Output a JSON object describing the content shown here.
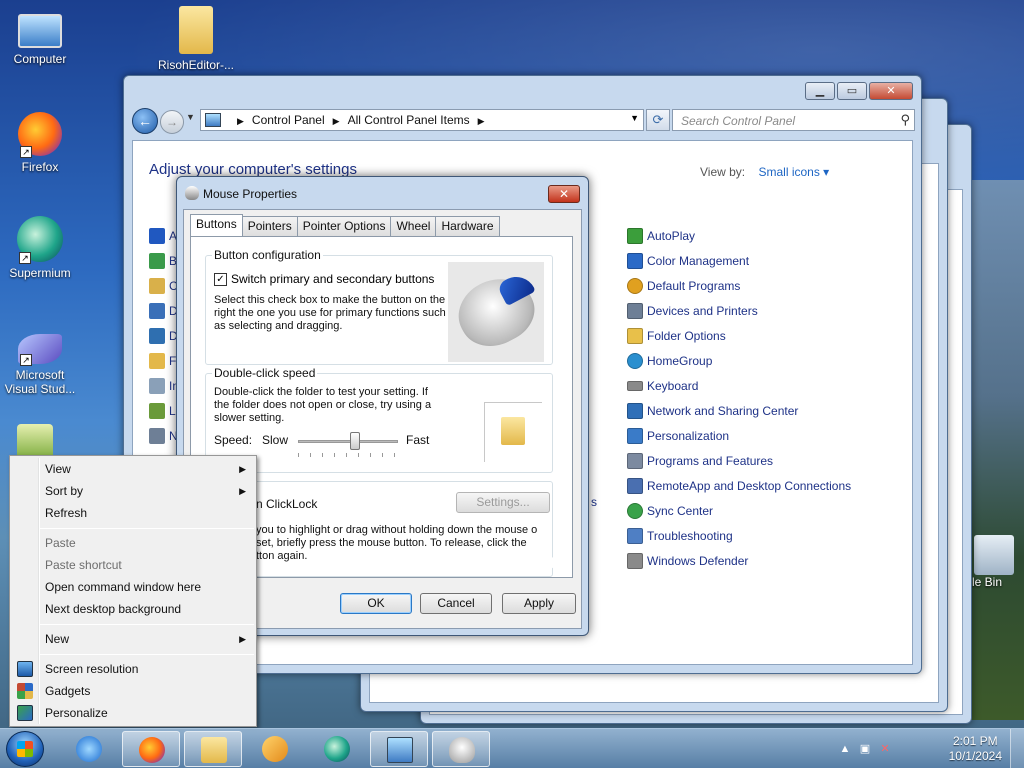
{
  "desktop": {
    "icons": [
      {
        "label": "Computer",
        "icon": "computer-icon"
      },
      {
        "label": "RisohEditor-...",
        "icon": "folder-icon"
      },
      {
        "label": "Firefox",
        "icon": "firefox-icon"
      },
      {
        "label": "Supermium",
        "icon": "supermium-icon"
      },
      {
        "label": "Microsoft Visual Stud...",
        "icon": "visual-studio-icon"
      },
      {
        "label": "cle Bin",
        "icon": "recycle-bin-icon"
      }
    ]
  },
  "explorer": {
    "breadcrumb": [
      "Control Panel",
      "All Control Panel Items"
    ],
    "search_placeholder": "Search Control Panel",
    "heading": "Adjust your computer's settings",
    "view_by_label": "View by:",
    "view_by_value": "Small icons",
    "left_items": [
      "A",
      "B",
      "C",
      "D",
      "D",
      "F",
      "In",
      "Lo",
      "N"
    ],
    "right_items": [
      {
        "label": "AutoPlay",
        "color": "#3b9e3b"
      },
      {
        "label": "Color Management",
        "color": "#2b6ac7"
      },
      {
        "label": "Default Programs",
        "color": "#e0a020"
      },
      {
        "label": "Devices and Printers",
        "color": "#6e7f96"
      },
      {
        "label": "Folder Options",
        "color": "#e8c04a"
      },
      {
        "label": "HomeGroup",
        "color": "#2a8fcf"
      },
      {
        "label": "Keyboard",
        "color": "#8a8a8a"
      },
      {
        "label": "Network and Sharing Center",
        "color": "#2f6fb8"
      },
      {
        "label": "Personalization",
        "color": "#3a7bc8"
      },
      {
        "label": "Programs and Features",
        "color": "#7c8aa0"
      },
      {
        "label": "RemoteApp and Desktop Connections",
        "color": "#4a6fb0"
      },
      {
        "label": "Sync Center",
        "color": "#3aa24a"
      },
      {
        "label": "Troubleshooting",
        "color": "#4f7fc4"
      },
      {
        "label": "Windows Defender",
        "color": "#8a8a8a"
      }
    ],
    "partial_text": "s"
  },
  "dialog": {
    "title": "Mouse Properties",
    "tabs": [
      "Buttons",
      "Pointers",
      "Pointer Options",
      "Wheel",
      "Hardware"
    ],
    "active_tab": "Buttons",
    "button_config": {
      "label": "Button configuration",
      "checkbox_label": "Switch primary and secondary buttons",
      "checked": true,
      "description": "Select this check box to make the button on the right the one you use for primary functions such as selecting and dragging."
    },
    "double_click": {
      "label": "Double-click speed",
      "description": "Double-click the folder to test your setting. If the folder does not open or close, try using a slower setting.",
      "speed_label": "Speed:",
      "slow_label": "Slow",
      "fast_label": "Fast",
      "speed_value": 0.57
    },
    "clicklock": {
      "label": "n ClickLock",
      "settings_button": "Settings...",
      "description": "you to highlight or drag without holding down the mouse o set, briefly press the mouse button. To release, click the tton again."
    },
    "buttons": {
      "ok": "OK",
      "cancel": "Cancel",
      "apply": "Apply"
    }
  },
  "context_menu": {
    "items": [
      {
        "label": "View",
        "submenu": true,
        "disabled": false
      },
      {
        "label": "Sort by",
        "submenu": true,
        "disabled": false
      },
      {
        "label": "Refresh",
        "submenu": false,
        "disabled": false
      },
      {
        "label": "Paste",
        "submenu": false,
        "disabled": true
      },
      {
        "label": "Paste shortcut",
        "submenu": false,
        "disabled": true
      },
      {
        "label": "Open command window here",
        "submenu": false,
        "disabled": false
      },
      {
        "label": "Next desktop background",
        "submenu": false,
        "disabled": false
      },
      {
        "label": "New",
        "submenu": true,
        "disabled": false
      },
      {
        "label": "Screen resolution",
        "submenu": false,
        "disabled": false,
        "icon": "screen-resolution-icon"
      },
      {
        "label": "Gadgets",
        "submenu": false,
        "disabled": false,
        "icon": "gadgets-icon"
      },
      {
        "label": "Personalize",
        "submenu": false,
        "disabled": false,
        "icon": "personalize-icon"
      }
    ]
  },
  "taskbar": {
    "apps": [
      "internet-explorer-icon",
      "firefox-icon",
      "explorer-icon",
      "media-player-icon",
      "supermium-icon",
      "control-panel-icon",
      "mouse-icon"
    ],
    "time": "2:01 PM",
    "date": "10/1/2024"
  }
}
